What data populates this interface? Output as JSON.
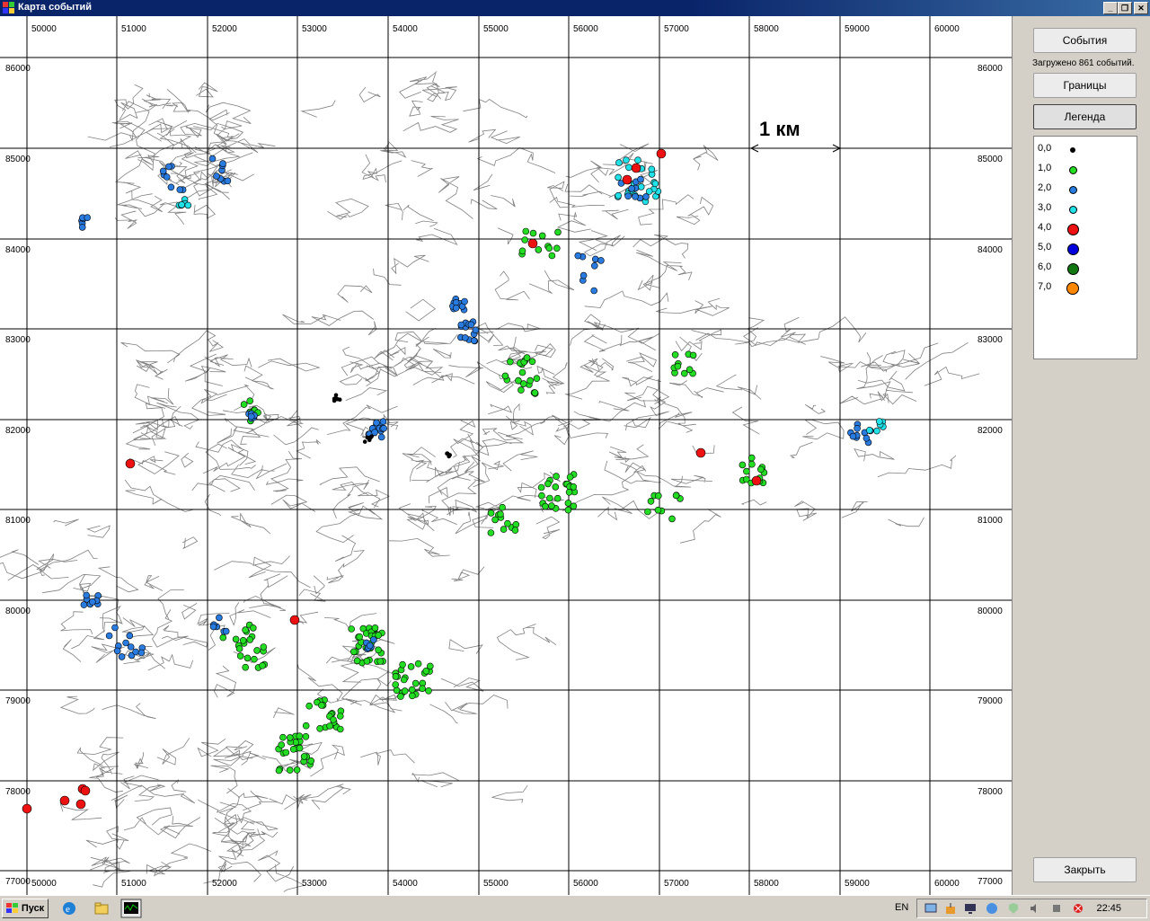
{
  "window": {
    "title": "Карта событий"
  },
  "map": {
    "x_ticks": [
      "50000",
      "51000",
      "52000",
      "53000",
      "54000",
      "55000",
      "56000",
      "57000",
      "58000",
      "59000",
      "60000"
    ],
    "y_ticks": [
      "86000",
      "85000",
      "84000",
      "83000",
      "82000",
      "81000",
      "80000",
      "79000",
      "78000",
      "77000"
    ],
    "scale_label": "1 км",
    "grid_color": "#000000",
    "contour_color": "#808080"
  },
  "panel": {
    "events_button": "События",
    "loaded_text": "Загружено 861 событий.",
    "bounds_button": "Границы",
    "legend_button": "Легенда",
    "close_button": "Закрыть"
  },
  "legend": [
    {
      "label": "0,0",
      "color": "#000000"
    },
    {
      "label": "1,0",
      "color": "#22dd22"
    },
    {
      "label": "2,0",
      "color": "#2a7be0"
    },
    {
      "label": "3,0",
      "color": "#20e0e8"
    },
    {
      "label": "4,0",
      "color": "#ee1111"
    },
    {
      "label": "5,0",
      "color": "#0000dd"
    },
    {
      "label": "6,0",
      "color": "#117711"
    },
    {
      "label": "7,0",
      "color": "#ff8800"
    }
  ],
  "taskbar": {
    "start_label": "Пуск",
    "lang": "EN",
    "clock": "22:45",
    "quicklaunch_icons": [
      "ie-icon",
      "folder-icon",
      "monitor-icon"
    ],
    "tray_icons": [
      "network-icon",
      "update-icon",
      "display-icon",
      "globe-icon",
      "shield-icon",
      "volume-icon",
      "power-icon",
      "alert-icon"
    ]
  }
}
